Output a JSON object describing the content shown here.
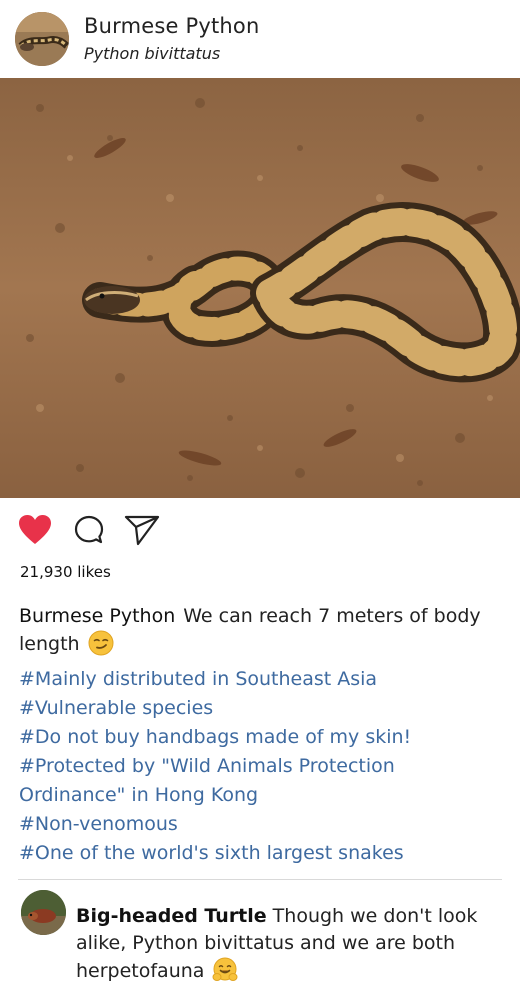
{
  "post": {
    "account_name": "Burmese Python",
    "account_subtitle": "Python bivittatus",
    "likes_text": "21,930 likes",
    "liked": true
  },
  "caption": {
    "user": "Burmese Python",
    "text": "We can reach 7 meters of body length",
    "emoji": "smirking-face"
  },
  "hashtags": [
    "#Mainly distributed in Southeast Asia",
    "#Vulnerable species",
    "#Do not buy handbags made of my skin!",
    "#Protected by \"Wild Animals Protection",
    "Ordinance\" in Hong Kong",
    "#Non-venomous",
    "#One of the world's sixth largest snakes"
  ],
  "comment": {
    "user": "Big-headed Turtle",
    "text": "Though we don't look alike, Python bivittatus and we are both herpetofauna",
    "emoji": "hugging-face"
  },
  "colors": {
    "like_red": "#e8324a",
    "hashtag_blue": "#3e6aa0",
    "divider": "#d9d9d9"
  },
  "icons": {
    "like": "heart-icon",
    "comment": "comment-bubble-icon",
    "share": "send-paper-plane-icon"
  }
}
